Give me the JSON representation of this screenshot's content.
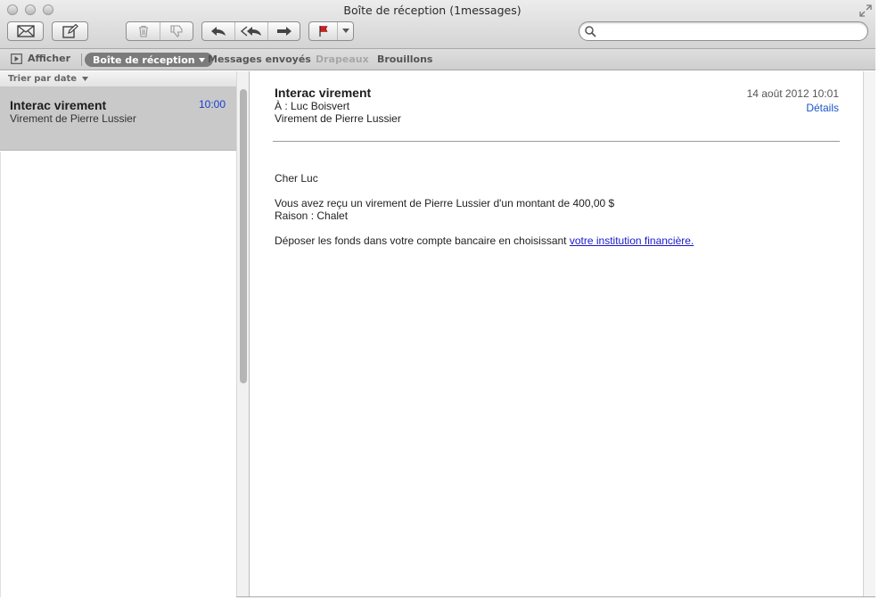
{
  "window": {
    "title": "Boîte de réception (1messages)"
  },
  "toolbar": {
    "get_mail_icon": "envelope-icon",
    "compose_icon": "compose-icon",
    "delete_icon": "trash-icon",
    "junk_icon": "thumbs-down-icon",
    "reply_icon": "reply-icon",
    "reply_all_icon": "reply-all-icon",
    "forward_icon": "forward-icon",
    "flag_icon": "flag-icon",
    "flag_color": "#d0201e",
    "search": {
      "placeholder": "",
      "value": ""
    }
  },
  "favorites": {
    "afficher": "Afficher",
    "inbox": "Boîte de réception",
    "sent": "Messages envoyés",
    "flags": "Drapeaux",
    "drafts": "Brouillons"
  },
  "list": {
    "sort_label": "Trier par date",
    "messages": [
      {
        "sender": "Interac virement",
        "time": "10:00",
        "subject": "Virement de Pierre Lussier"
      }
    ]
  },
  "message": {
    "subject": "Interac virement",
    "to": "À : Luc Boisvert",
    "from_line": "Virement de Pierre Lussier",
    "date": "14 août 2012 10:01",
    "details_link": "Détails",
    "body": {
      "greeting": "Cher Luc",
      "line1": "Vous avez reçu un virement de Pierre Lussier d'un montant de 400,00 $",
      "line2": "Raison : Chalet",
      "line3_prefix": "Déposer les fonds dans votre compte bancaire en choisissant ",
      "line3_link": "votre institution financière."
    }
  },
  "colors": {
    "time_color": "#1a3ccf",
    "link_color": "#1a1ac9",
    "selected_row": "#c9c9c9"
  }
}
